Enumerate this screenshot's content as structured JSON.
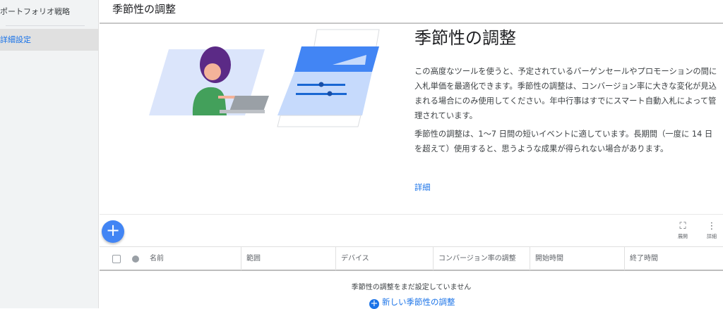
{
  "sidebar": {
    "items": [
      {
        "label": "ポートフォリオ戦略"
      },
      {
        "label": "詳細設定"
      }
    ]
  },
  "header": {
    "title": "季節性の調整"
  },
  "hero": {
    "title": "季節性の調整",
    "paragraph1": "この高度なツールを使うと、予定されているバーゲンセールやプロモーションの間に入札単価を最適化できます。季節性の調整は、コンバージョン率に大きな変化が見込まれる場合にのみ使用してください。年中行事はすでにスマート自動入札によって管理されています。",
    "paragraph2": "季節性の調整は、1〜7 日間の短いイベントに適しています。長期間（一度に 14 日を超えて）使用すると、思うような成果が得られない場合があります。",
    "learn_more": "詳細"
  },
  "toolbar": {
    "add_icon": "plus-icon",
    "expand_label": "展開",
    "more_label": "詳細"
  },
  "table": {
    "columns": [
      "名前",
      "範囲",
      "デバイス",
      "コンバージョン率の調整",
      "開始時間",
      "終了時間"
    ]
  },
  "empty_state": {
    "message": "季節性の調整をまだ設定していません",
    "new_label": "新しい季節性の調整"
  },
  "colors": {
    "accent": "#1a73e8",
    "fab": "#4285f4"
  }
}
